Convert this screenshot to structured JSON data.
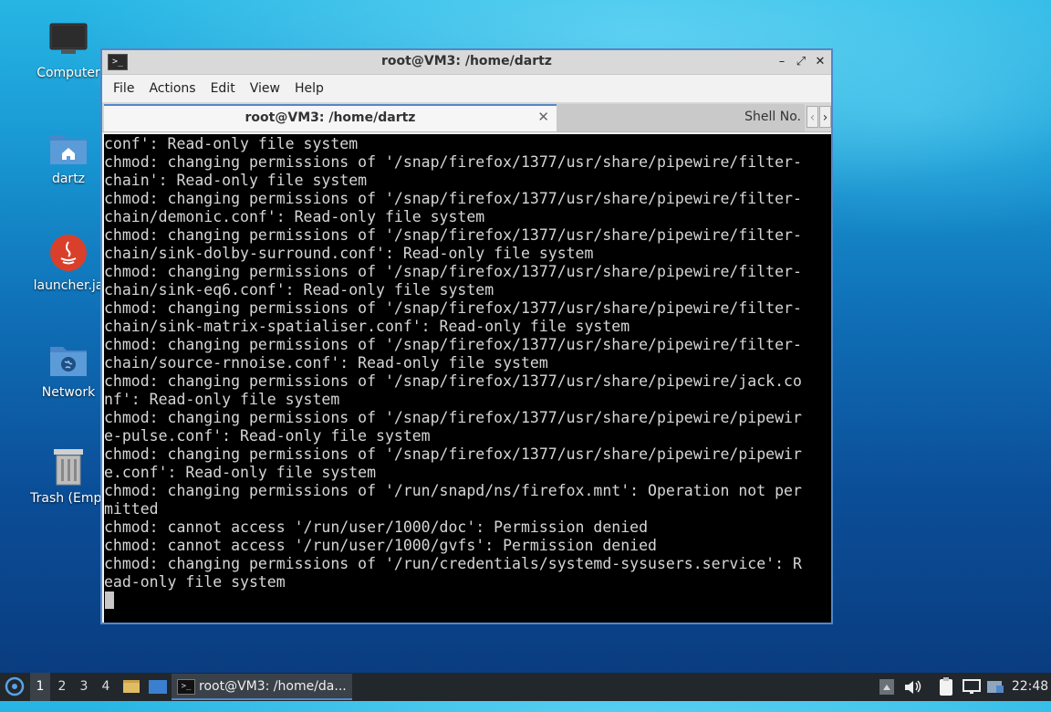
{
  "desktop": {
    "icons": [
      {
        "label": "Computer",
        "icon": "computer-icon"
      },
      {
        "label": "dartz",
        "icon": "home-folder-icon"
      },
      {
        "label": "launcher.ja",
        "icon": "java-icon"
      },
      {
        "label": "Network",
        "icon": "network-folder-icon"
      },
      {
        "label": "Trash (Empt",
        "icon": "trash-icon"
      }
    ]
  },
  "window": {
    "title": "root@VM3: /home/dartz",
    "controls": {
      "minimize": "–",
      "maximize": "⤢",
      "close": "✕"
    },
    "menu": [
      "File",
      "Actions",
      "Edit",
      "View",
      "Help"
    ],
    "tabs": [
      {
        "label": "root@VM3: /home/dartz",
        "active": true
      },
      {
        "label": "Shell No.",
        "active": false
      }
    ],
    "tab_scroll": {
      "left": "‹",
      "right": "›"
    }
  },
  "terminal": {
    "lines": [
      "conf': Read-only file system",
      "chmod: changing permissions of '/snap/firefox/1377/usr/share/pipewire/filter-",
      "chain': Read-only file system",
      "chmod: changing permissions of '/snap/firefox/1377/usr/share/pipewire/filter-",
      "chain/demonic.conf': Read-only file system",
      "chmod: changing permissions of '/snap/firefox/1377/usr/share/pipewire/filter-",
      "chain/sink-dolby-surround.conf': Read-only file system",
      "chmod: changing permissions of '/snap/firefox/1377/usr/share/pipewire/filter-",
      "chain/sink-eq6.conf': Read-only file system",
      "chmod: changing permissions of '/snap/firefox/1377/usr/share/pipewire/filter-",
      "chain/sink-matrix-spatialiser.conf': Read-only file system",
      "chmod: changing permissions of '/snap/firefox/1377/usr/share/pipewire/filter-",
      "chain/source-rnnoise.conf': Read-only file system",
      "chmod: changing permissions of '/snap/firefox/1377/usr/share/pipewire/jack.co",
      "nf': Read-only file system",
      "chmod: changing permissions of '/snap/firefox/1377/usr/share/pipewire/pipewir",
      "e-pulse.conf': Read-only file system",
      "chmod: changing permissions of '/snap/firefox/1377/usr/share/pipewire/pipewir",
      "e.conf': Read-only file system",
      "chmod: changing permissions of '/run/snapd/ns/firefox.mnt': Operation not per",
      "mitted",
      "chmod: cannot access '/run/user/1000/doc': Permission denied",
      "chmod: cannot access '/run/user/1000/gvfs': Permission denied",
      "chmod: changing permissions of '/run/credentials/systemd-sysusers.service': R",
      "ead-only file system"
    ]
  },
  "taskbar": {
    "workspaces": [
      "1",
      "2",
      "3",
      "4"
    ],
    "active_workspace": "1",
    "task_label": "root@VM3: /home/da...",
    "clock": "22:48"
  }
}
